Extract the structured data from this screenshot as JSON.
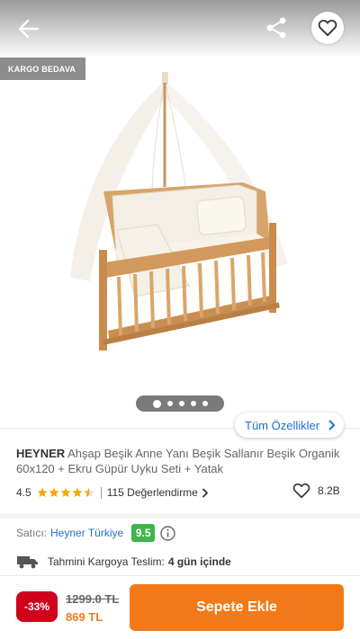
{
  "badges": {
    "cargo": "KARGO BEDAVA"
  },
  "header": {
    "back_icon": "arrow-left-icon",
    "share_icon": "share-icon",
    "favorite_icon": "heart-outline-icon"
  },
  "gallery": {
    "image_count": 5,
    "active_index": 0,
    "image_desc": "baby-crib-product-photo"
  },
  "features_button": {
    "label": "Tüm Özellikler"
  },
  "product": {
    "brand": "HEYNER",
    "name": "Ahşap Beşik Anne Yanı Beşik Sallanır Beşik Organik 60x120 + Ekru Güpür Uyku Seti + Yatak",
    "rating": "4.5",
    "rating_value": 4.5,
    "reviews": "115 Değerlendirme",
    "favorites": "8.2B"
  },
  "seller": {
    "label": "Satıcı:",
    "name": "Heyner Türkiye",
    "score": "9.5"
  },
  "delivery": {
    "label": "Tahmini Kargoya Teslim:",
    "value": "4 gün içinde"
  },
  "pricing": {
    "discount": "-33%",
    "old_price": "1299.0 TL",
    "new_price": "869 TL"
  },
  "cart_button": {
    "label": "Sepete Ekle"
  },
  "colors": {
    "accent": "#f27a1a",
    "link": "#1f6fd0",
    "discount": "#d0021b",
    "score": "#3eb54b",
    "star": "#f2a900"
  }
}
